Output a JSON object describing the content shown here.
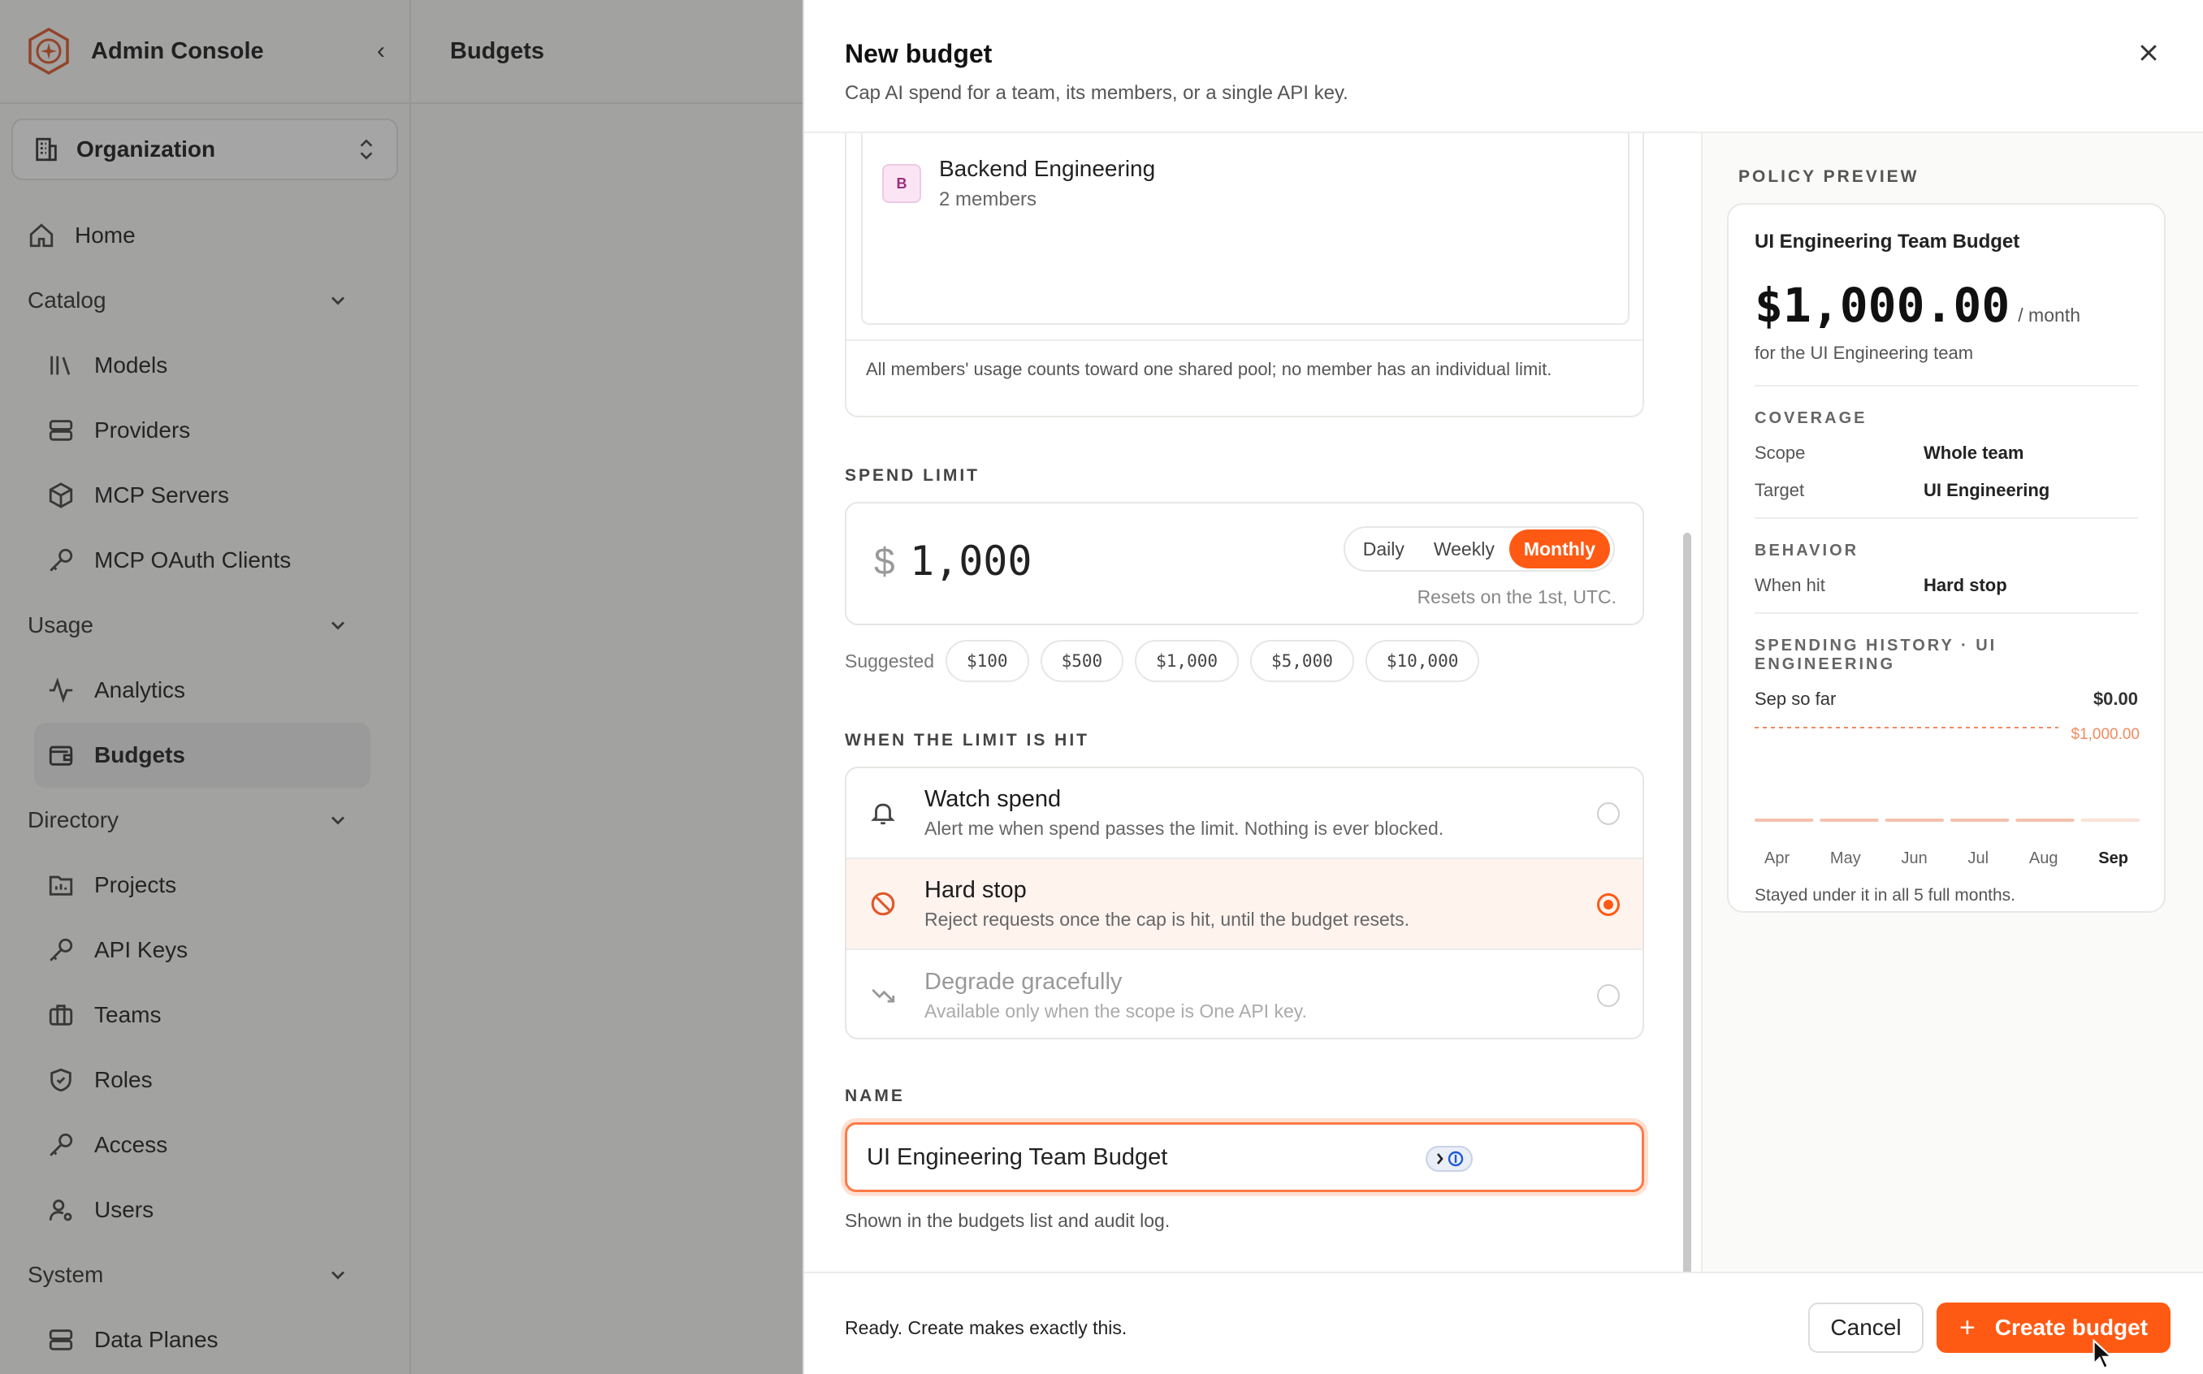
{
  "app": {
    "title": "Admin Console"
  },
  "org_switcher": {
    "label": "Organization"
  },
  "nav": {
    "home": "Home",
    "catalog": {
      "label": "Catalog",
      "items": [
        "Models",
        "Providers",
        "MCP Servers",
        "MCP OAuth Clients"
      ]
    },
    "usage": {
      "label": "Usage",
      "items": [
        "Analytics",
        "Budgets"
      ]
    },
    "directory": {
      "label": "Directory",
      "items": [
        "Projects",
        "API Keys",
        "Teams",
        "Roles",
        "Access",
        "Users"
      ]
    },
    "system": {
      "label": "System",
      "items": [
        "Data Planes"
      ]
    }
  },
  "page": {
    "title": "Budgets"
  },
  "drawer": {
    "title": "New budget",
    "subtitle": "Cap AI spend for a team, its members, or a single API key.",
    "team": {
      "initial": "B",
      "name": "Backend Engineering",
      "members": "2 members"
    },
    "pool_note": "All members' usage counts toward one shared pool; no member has an individual limit.",
    "spend_limit": {
      "label": "SPEND LIMIT",
      "currency": "$",
      "amount": "1,000",
      "periods": [
        "Daily",
        "Weekly",
        "Monthly"
      ],
      "selected_period": "Monthly",
      "resets": "Resets on the 1st, UTC.",
      "suggested_label": "Suggested",
      "suggested": [
        "$100",
        "$500",
        "$1,000",
        "$5,000",
        "$10,000"
      ]
    },
    "limit_hit": {
      "label": "WHEN THE LIMIT IS HIT",
      "options": [
        {
          "title": "Watch spend",
          "desc": "Alert me when spend passes the limit. Nothing is ever blocked.",
          "selected": false,
          "disabled": false
        },
        {
          "title": "Hard stop",
          "desc": "Reject requests once the cap is hit, until the budget resets.",
          "selected": true,
          "disabled": false
        },
        {
          "title": "Degrade gracefully",
          "desc": "Available only when the scope is One API key.",
          "selected": false,
          "disabled": true
        }
      ]
    },
    "name": {
      "label": "NAME",
      "value": "UI Engineering Team Budget",
      "help": "Shown in the budgets list and audit log."
    },
    "preview": {
      "label": "POLICY PREVIEW",
      "name": "UI Engineering Team Budget",
      "amount": "$1,000.00",
      "per": "/ month",
      "for": "for the UI Engineering team",
      "coverage_label": "COVERAGE",
      "scope_k": "Scope",
      "scope_v": "Whole team",
      "target_k": "Target",
      "target_v": "UI Engineering",
      "behavior_label": "BEHAVIOR",
      "hit_k": "When hit",
      "hit_v": "Hard stop",
      "history_label": "SPENDING HISTORY · UI ENGINEERING",
      "so_far_k": "Sep so far",
      "so_far_v": "$0.00",
      "limit_line": "$1,000.00",
      "footnote": "Stayed under it in all 5 full months."
    },
    "footer": {
      "status": "Ready. Create makes exactly this.",
      "cancel": "Cancel",
      "create": "Create budget"
    }
  },
  "chart_data": {
    "type": "bar",
    "categories": [
      "Apr",
      "May",
      "Jun",
      "Jul",
      "Aug",
      "Sep"
    ],
    "values": [
      0,
      0,
      0,
      0,
      0,
      0
    ],
    "limit": 1000,
    "ylim": [
      0,
      1000
    ],
    "colors": {
      "bar": "#f4c2ad",
      "current_bar": "#fbe2d7",
      "limit_line": "#f08a5d"
    }
  },
  "colors": {
    "accent": "#ff5a14"
  }
}
